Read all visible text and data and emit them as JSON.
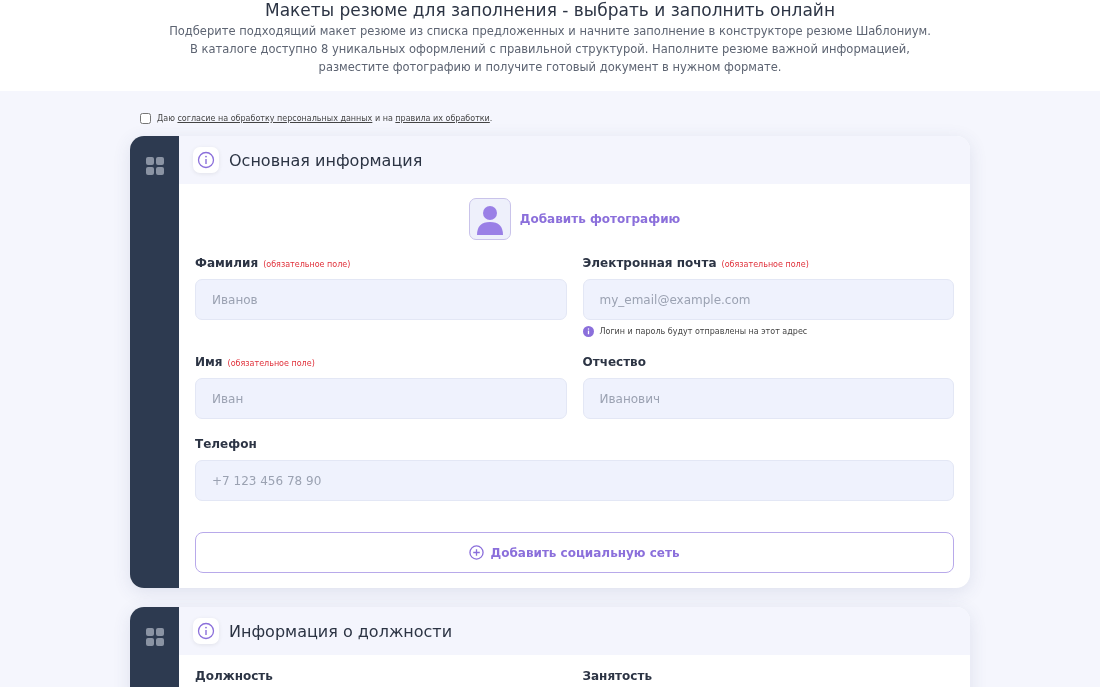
{
  "page_title": "Макеты резюме для заполнения - выбрать и заполнить онлайн",
  "intro": [
    "Подберите подходящий макет резюме из списка предложенных и начните заполнение в конструкторе резюме Шаблониум.",
    "В каталоге доступно 8 уникальных оформлений с правильной структурой. Наполните резюме важной информацией,",
    "разместите фотографию и получите готовый документ в нужном формате."
  ],
  "consent": {
    "checked": false,
    "prefix": "Даю",
    "link1": "согласие на обработку персональных данных",
    "middle": "и на",
    "link2": "правила их обработки",
    "suffix": "."
  },
  "sections": [
    {
      "title": "Основная информация",
      "photo_button": "Добавить фотографию",
      "fields": [
        {
          "label": "Фамилия",
          "required": "(обязательное поле)",
          "placeholder": "Иванов"
        },
        {
          "label": "Электронная почта",
          "required": "(обязательное поле)",
          "placeholder": "my_email@example.com",
          "hint": "Логин и пароль будут отправлены на этот адрес"
        },
        {
          "label": "Имя",
          "required": "(обязательное поле)",
          "placeholder": "Иван"
        },
        {
          "label": "Отчество",
          "placeholder": "Иванович"
        },
        {
          "label": "Телефон",
          "placeholder": "+7 123 456 78 90"
        }
      ],
      "add_button": "Добавить социальную сеть"
    },
    {
      "title": "Информация о должности",
      "fields": [
        {
          "label": "Должность"
        },
        {
          "label": "Занятость"
        }
      ]
    }
  ]
}
